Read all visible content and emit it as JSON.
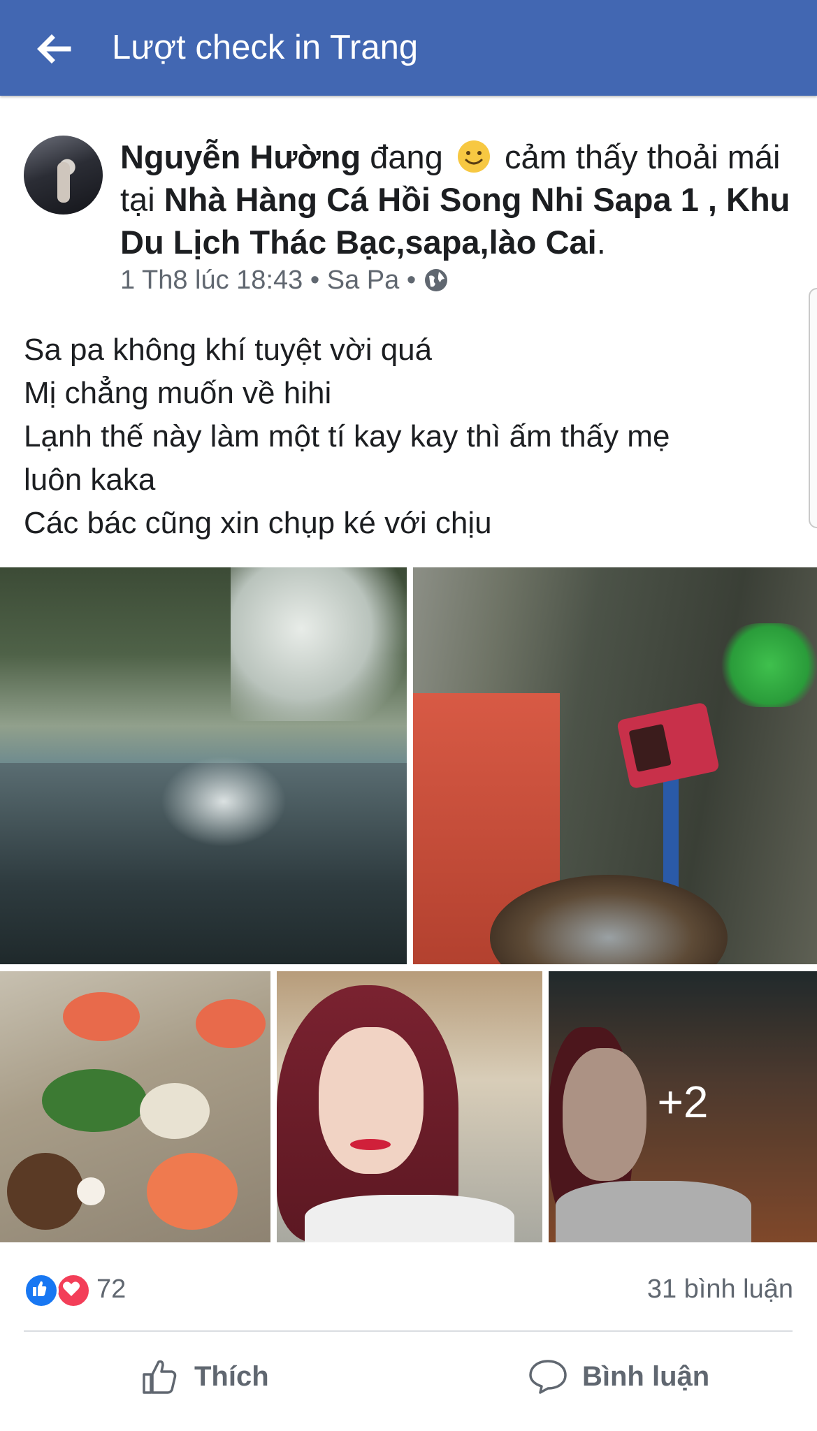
{
  "appbar": {
    "title": "Lượt check in Trang",
    "back_icon": "arrow-left-icon"
  },
  "post": {
    "author": "Nguyễn Hường",
    "feeling_prefix": "đang",
    "feeling_text": "cảm thấy thoải mái tại",
    "place": "Nhà Hàng Cá Hồi Song Nhi Sapa 1 , Khu Du Lịch Thác Bạc,sapa,lào Cai",
    "place_suffix": ".",
    "timestamp": "1 Th8 lúc 18:43",
    "location": "Sa Pa",
    "separator": "•",
    "privacy_icon": "globe-icon",
    "body_lines": [
      "Sa pa không khí tuyệt vời quá",
      "Mị chẳng muốn về hihi",
      "Lạnh thế này làm một tí kay kay thì ấm thấy mẹ",
      "luôn kaka",
      "Các bác cũng xin chụp ké với chịu"
    ],
    "more_photos": "+2"
  },
  "stats": {
    "reaction_count": "72",
    "comment_count": "31 bình luận"
  },
  "actions": {
    "like_label": "Thích",
    "comment_label": "Bình luận"
  },
  "colors": {
    "appbar": "#4267b2",
    "like_blue": "#1877f2",
    "love_red": "#f33e58",
    "meta_gray": "#606770"
  }
}
